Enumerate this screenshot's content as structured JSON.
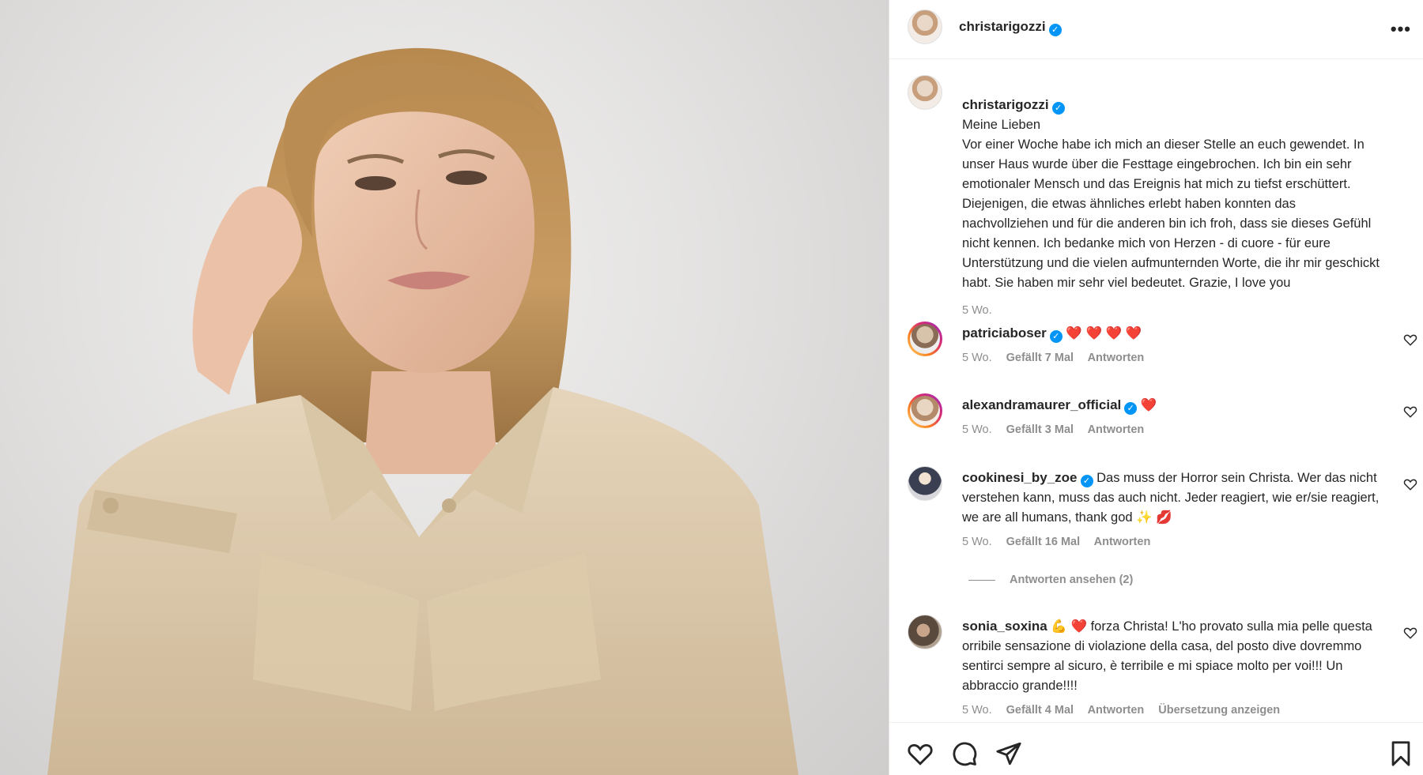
{
  "post": {
    "author": "christarigozzi",
    "more_icon": "more-horizontal-icon"
  },
  "caption": {
    "author": "christarigozzi",
    "text": "Meine Lieben\nVor einer Woche habe ich mich an dieser Stelle an euch gewendet. In unser Haus wurde über die Festtage eingebrochen. Ich bin ein sehr emotionaler Mensch und das Ereignis hat mich zu tiefst erschüttert. Diejenigen, die etwas ähnliches erlebt haben konnten das nachvollziehen und für die anderen bin ich froh, dass sie dieses Gefühl nicht kennen. Ich bedanke mich von Herzen - di cuore - für eure Unterstützung und die vielen aufmunternden Worte, die ihr mir geschickt habt. Sie haben mir sehr viel bedeutet. Grazie, I love you",
    "time": "5 Wo."
  },
  "comments": [
    {
      "author": "patriciaboser",
      "text": "❤️ ❤️  ❤️ ❤️",
      "time": "5 Wo.",
      "likes": "Gefällt 7 Mal",
      "reply": "Antworten"
    },
    {
      "author": "alexandramaurer_official",
      "text": "❤️",
      "time": "5 Wo.",
      "likes": "Gefällt 3 Mal",
      "reply": "Antworten"
    },
    {
      "author": "cookinesi_by_zoe",
      "text": "Das muss der Horror sein Christa. Wer das nicht verstehen kann, muss das auch nicht. Jeder reagiert, wie er/sie reagiert, we are all humans, thank god ✨ 💋",
      "time": "5 Wo.",
      "likes": "Gefällt 16 Mal",
      "reply": "Antworten"
    },
    {
      "author": "sonia_soxina",
      "text": "💪 ❤️  forza Christa! L'ho provato sulla mia pelle questa orribile sensazione di violazione della casa, del posto dive dovremmo sentirci sempre al sicuro, è terribile e mi spiace molto per voi!!! Un abbraccio grande!!!!",
      "time": "5 Wo.",
      "likes": "Gefällt 4 Mal",
      "reply": "Antworten",
      "translate": "Übersetzung anzeigen"
    }
  ],
  "view_replies": "Antworten ansehen (2)",
  "actions": {
    "like_icon": "heart-icon",
    "comment_icon": "comment-icon",
    "share_icon": "share-icon",
    "save_icon": "bookmark-icon"
  },
  "colors": {
    "verified": "#0095f6",
    "heart": "#ed4956",
    "secondary_text": "#8e8e8e"
  }
}
